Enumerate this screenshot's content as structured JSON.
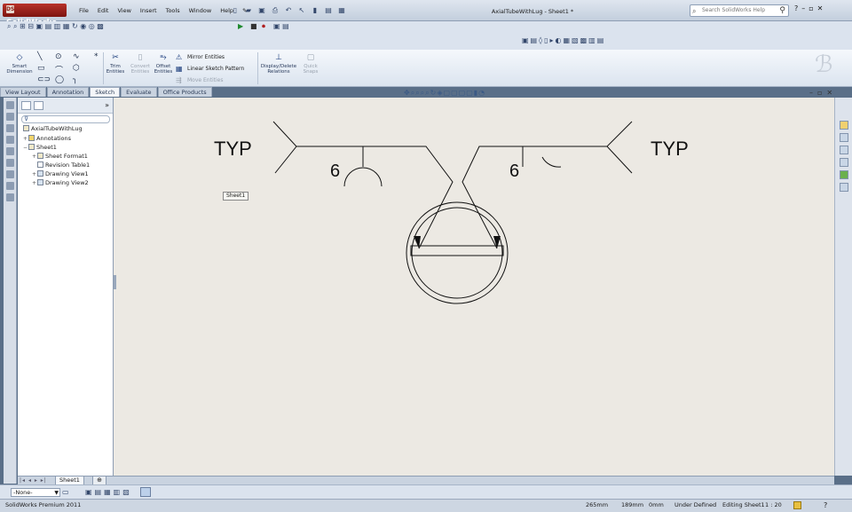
{
  "app": {
    "name": "SolidWorks",
    "title": "AxialTubeWithLug - Sheet1 *"
  },
  "menu": [
    "File",
    "Edit",
    "View",
    "Insert",
    "Tools",
    "Window",
    "Help"
  ],
  "search": {
    "placeholder": "Search SolidWorks Help"
  },
  "commands": {
    "smart_dimension": "Smart Dimension",
    "trim_entities": "Trim Entities",
    "convert_entities": "Convert Entities",
    "offset_entities": "Offset Entities",
    "mirror_entities": "Mirror Entities",
    "linear_sketch_pattern": "Linear Sketch Pattern",
    "move_entities": "Move Entities",
    "display_delete_relations": "Display/Delete Relations",
    "quick_snaps": "Quick Snaps"
  },
  "tabs": [
    {
      "label": "View Layout",
      "active": false
    },
    {
      "label": "Annotation",
      "active": false
    },
    {
      "label": "Sketch",
      "active": true
    },
    {
      "label": "Evaluate",
      "active": false
    },
    {
      "label": "Office Products",
      "active": false
    }
  ],
  "tree": {
    "root": "AxialTubeWithLug",
    "annotations": "Annotations",
    "sheet": "Sheet1",
    "sheet_format": "Sheet Format1",
    "revision_table": "Revision Table1",
    "drawing_view1": "Drawing View1",
    "drawing_view2": "Drawing View2"
  },
  "drawing": {
    "weld_left_note": "TYP",
    "weld_right_note": "TYP",
    "weld_left_size": "6",
    "weld_right_size": "6",
    "sheet_tooltip": "Sheet1"
  },
  "sheet_tab": "Sheet1",
  "layer": {
    "value": "-None-"
  },
  "status": {
    "product": "SolidWorks Premium 2011",
    "x": "265mm",
    "y": "189mm",
    "z": "0mm",
    "definition": "Under Defined",
    "mode": "Editing Sheet1",
    "scale": "1 : 20"
  },
  "colors": {
    "canvas": "#ece9e3",
    "accent": "#b8322a"
  }
}
